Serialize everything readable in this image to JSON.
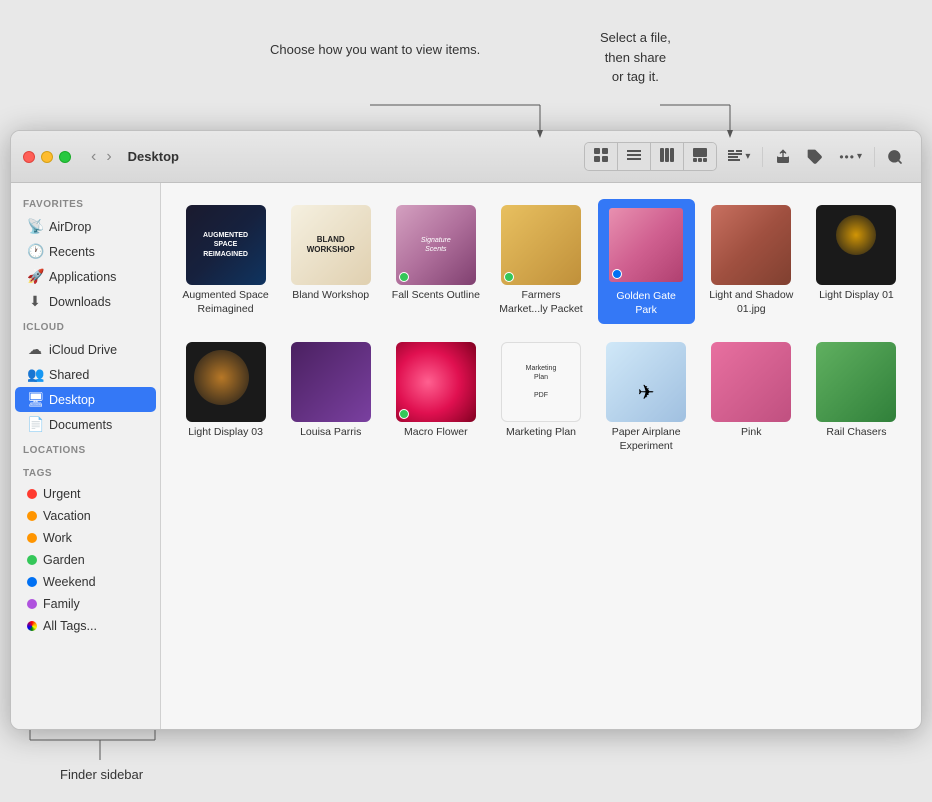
{
  "window": {
    "title": "Desktop"
  },
  "callouts": {
    "view_callout": "Choose how you\nwant to view items.",
    "share_callout": "Select a file,\nthen share\nor tag it.",
    "sidebar_callout": "Finder sidebar"
  },
  "toolbar": {
    "back": "‹",
    "forward": "›",
    "view_icon": "⊞",
    "list_icon": "≡",
    "column_icon": "⫴",
    "gallery_icon": "▦",
    "group_icon": "⊞",
    "group_dropdown": "▾",
    "share_icon": "↑",
    "tag_icon": "⌖",
    "more_icon": "•••",
    "more_dropdown": "▾",
    "search_icon": "⌕"
  },
  "sidebar": {
    "sections": [
      {
        "header": "Favorites",
        "items": [
          {
            "icon": "airdrop",
            "label": "AirDrop"
          },
          {
            "icon": "recents",
            "label": "Recents"
          },
          {
            "icon": "applications",
            "label": "Applications"
          },
          {
            "icon": "downloads",
            "label": "Downloads"
          }
        ]
      },
      {
        "header": "iCloud",
        "items": [
          {
            "icon": "icloud-drive",
            "label": "iCloud Drive"
          },
          {
            "icon": "shared",
            "label": "Shared"
          },
          {
            "icon": "desktop",
            "label": "Desktop",
            "active": true
          },
          {
            "icon": "documents",
            "label": "Documents"
          }
        ]
      },
      {
        "header": "Locations",
        "items": []
      },
      {
        "header": "Tags",
        "items": [
          {
            "tag": true,
            "color": "#ff3b30",
            "label": "Urgent"
          },
          {
            "tag": true,
            "color": "#ff9500",
            "label": "Vacation"
          },
          {
            "tag": true,
            "color": "#ff9500",
            "label": "Work"
          },
          {
            "tag": true,
            "color": "#34c759",
            "label": "Garden"
          },
          {
            "tag": true,
            "color": "#0070f3",
            "label": "Weekend"
          },
          {
            "tag": true,
            "color": "#af52de",
            "label": "Family"
          },
          {
            "tag": true,
            "color": "#aaa",
            "label": "All Tags..."
          }
        ]
      }
    ]
  },
  "files": [
    {
      "name": "Augmented Space Reimagined",
      "thumb": "augmented",
      "label": "Augmented Space Reimagined",
      "selected": false,
      "tag_color": null
    },
    {
      "name": "Bland Workshop",
      "thumb": "bland",
      "label": "Bland Workshop",
      "selected": false,
      "tag_color": null
    },
    {
      "name": "Fall Scents Outline",
      "thumb": "fall-scents",
      "label": "Fall Scents Outline",
      "selected": false,
      "tag_color": "#34c759"
    },
    {
      "name": "Farmers Market...ly Packet",
      "thumb": "farmers",
      "label": "Farmers Market...ly Packet",
      "selected": false,
      "tag_color": "#34c759"
    },
    {
      "name": "Golden Gate Park",
      "thumb": "golden-gate",
      "label": "Golden Gate Park",
      "selected": true,
      "tag_color": "#0070f3"
    },
    {
      "name": "Light and Shadow 01.jpg",
      "thumb": "light-shadow",
      "label": "Light and Shadow 01.jpg",
      "selected": false,
      "tag_color": null
    },
    {
      "name": "Light Display 01",
      "thumb": "light-display-01",
      "label": "Light Display 01",
      "selected": false,
      "tag_color": null
    },
    {
      "name": "Light Display 03",
      "thumb": "light-display-03",
      "label": "Light Display 03",
      "selected": false,
      "tag_color": null
    },
    {
      "name": "Louisa Parris",
      "thumb": "louisa",
      "label": "Louisa Parris",
      "selected": false,
      "tag_color": null
    },
    {
      "name": "Macro Flower",
      "thumb": "macro-flower",
      "label": "Macro Flower",
      "selected": false,
      "tag_color": "#34c759"
    },
    {
      "name": "Marketing Plan",
      "thumb": "marketing",
      "label": "Marketing Plan",
      "selected": false,
      "tag_color": null
    },
    {
      "name": "Paper Airplane Experiment",
      "thumb": "paper-airplane",
      "label": "Paper Airplane Experiment",
      "selected": false,
      "tag_color": null
    },
    {
      "name": "Pink",
      "thumb": "pink",
      "label": "Pink",
      "selected": false,
      "tag_color": null
    },
    {
      "name": "Rail Chasers",
      "thumb": "rail",
      "label": "Rail Chasers",
      "selected": false,
      "tag_color": null
    }
  ]
}
